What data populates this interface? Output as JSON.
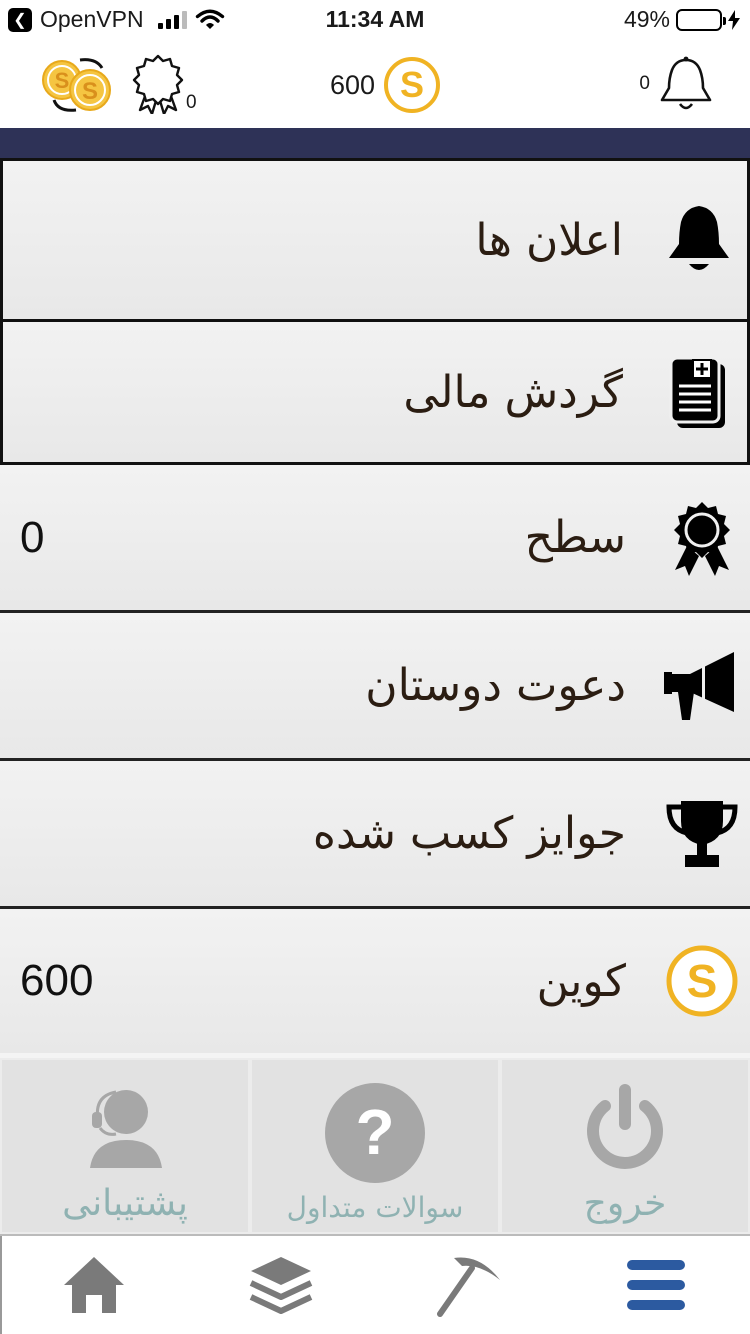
{
  "status_bar": {
    "back_app": "OpenVPN",
    "time": "11:34 AM",
    "battery_percent": "49%",
    "battery_level": 0.49
  },
  "header": {
    "badge_count": "0",
    "coin_balance": "600",
    "notification_count": "0",
    "coin_color": "#f0b323"
  },
  "menu": {
    "items": [
      {
        "label": "اعلان ها",
        "icon": "bell-icon",
        "value": ""
      },
      {
        "label": "گردش مالی",
        "icon": "document-icon",
        "value": ""
      },
      {
        "label": "سطح",
        "icon": "medal-icon",
        "value": "0"
      },
      {
        "label": "دعوت دوستان",
        "icon": "megaphone-icon",
        "value": ""
      },
      {
        "label": "جوایز کسب شده",
        "icon": "trophy-icon",
        "value": ""
      },
      {
        "label": "کوین",
        "icon": "coin-icon",
        "value": "600"
      }
    ]
  },
  "quick_actions": {
    "support": "پشتیبانی",
    "faq": "سوالات متداول",
    "logout": "خروج"
  },
  "tabbar": {
    "tabs": [
      "home-icon",
      "layers-icon",
      "pickaxe-icon",
      "menu-icon"
    ],
    "active_color": "#2c5aa0"
  }
}
